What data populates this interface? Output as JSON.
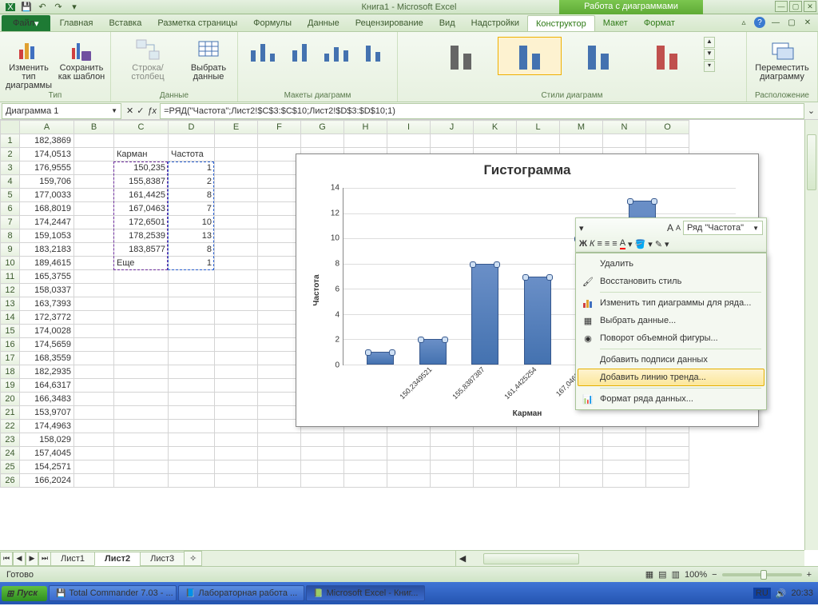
{
  "window": {
    "app_title": "Книга1  -  Microsoft Excel",
    "context_title": "Работа с диаграммами"
  },
  "tabs": {
    "file": "Файл",
    "home": "Главная",
    "insert": "Вставка",
    "page_layout": "Разметка страницы",
    "formulas": "Формулы",
    "data": "Данные",
    "review": "Рецензирование",
    "view": "Вид",
    "addins": "Надстройки",
    "design": "Конструктор",
    "layout": "Макет",
    "format": "Формат"
  },
  "ribbon": {
    "type_group": "Тип",
    "change_type": "Изменить тип\nдиаграммы",
    "save_template": "Сохранить\nкак шаблон",
    "data_group": "Данные",
    "switch": "Строка/столбец",
    "select_data": "Выбрать\nданные",
    "layouts_group": "Макеты диаграмм",
    "styles_group": "Стили диаграмм",
    "location_group": "Расположение",
    "move_chart": "Переместить\nдиаграмму"
  },
  "namebox": "Диаграмма 1",
  "formula": "=РЯД(\"Частота\";Лист2!$C$3:$C$10;Лист2!$D$3:$D$10;1)",
  "columns": [
    "A",
    "B",
    "C",
    "D",
    "E",
    "F",
    "G",
    "H",
    "I",
    "J",
    "K",
    "L",
    "M",
    "N",
    "O"
  ],
  "colA": [
    "182,3869",
    "174,0513",
    "176,9555",
    "159,706",
    "177,0033",
    "168,8019",
    "174,2447",
    "159,1053",
    "183,2183",
    "189,4615",
    "165,3755",
    "158,0337",
    "163,7393",
    "172,3772",
    "174,0028",
    "174,5659",
    "168,3559",
    "182,2935",
    "164,6317",
    "166,3483",
    "153,9707",
    "174,4963",
    "158,029",
    "157,4045",
    "154,2571",
    "166,2024"
  ],
  "hdrC": "Карман",
  "hdrD": "Частота",
  "colC": [
    "150,235",
    "155,8387",
    "161,4425",
    "167,0463",
    "172,6501",
    "178,2539",
    "183,8577",
    "Еще"
  ],
  "colD": [
    "1",
    "2",
    "8",
    "7",
    "10",
    "13",
    "8",
    "1"
  ],
  "chart_data": {
    "type": "bar",
    "title": "Гистограмма",
    "xlabel": "Карман",
    "ylabel": "Частота",
    "ylim": [
      0,
      14
    ],
    "yticks": [
      0,
      2,
      4,
      6,
      8,
      10,
      12,
      14
    ],
    "categories": [
      "150,2349521",
      "155,8387387",
      "161,4425254",
      "167,046312",
      "172,6500987",
      "178,2538853",
      "183,8576719"
    ],
    "values": [
      1,
      2,
      8,
      7,
      10,
      13,
      8
    ]
  },
  "mini_toolbar": {
    "series": "Ряд \"Частота\""
  },
  "context_menu": {
    "delete": "Удалить",
    "reset_style": "Восстановить стиль",
    "change_type": "Изменить тип диаграммы для ряда...",
    "select_data": "Выбрать данные...",
    "rotate3d": "Поворот объемной фигуры...",
    "add_labels": "Добавить подписи данных",
    "add_trendline": "Добавить линию тренда...",
    "format_series": "Формат ряда данных..."
  },
  "sheets": {
    "s1": "Лист1",
    "s2": "Лист2",
    "s3": "Лист3"
  },
  "status": {
    "ready": "Готово",
    "zoom": "100%"
  },
  "taskbar": {
    "start": "Пуск",
    "tc": "Total Commander 7.03 - ...",
    "word": "Лабораторная работа ...",
    "excel": "Microsoft Excel - Книг...",
    "lang": "RU",
    "time": "20:33"
  }
}
